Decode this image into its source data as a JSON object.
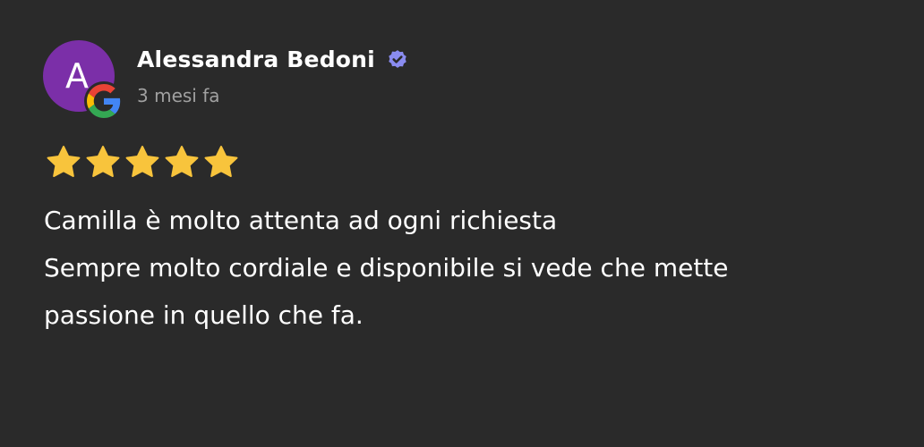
{
  "review": {
    "author": {
      "name": "Alessandra Bedoni",
      "initial": "A",
      "avatar_color": "#7b2fa8",
      "verified_icon": "verified-badge-icon",
      "verified_color": "#8a8cf0"
    },
    "source_icon": "google-g-icon",
    "date": "3 mesi fa",
    "rating": 5,
    "rating_max": 5,
    "star_color": "#f8c43c",
    "text_lines": [
      "Camilla è molto attenta ad ogni richiesta",
      "Sempre molto cordiale e disponibile si vede che mette",
      "passione in quello che fa."
    ]
  },
  "colors": {
    "background": "#2a2a2a",
    "text": "#ffffff",
    "muted_text": "#a0a0a0"
  }
}
